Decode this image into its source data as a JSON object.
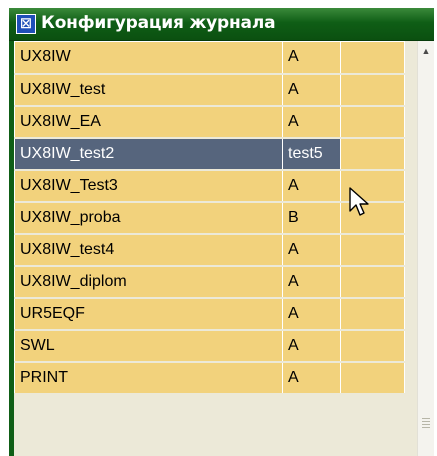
{
  "window": {
    "title": "Конфигурация журнала",
    "icon": "app-icon"
  },
  "rows": [
    {
      "name": "UX8IW",
      "value": "A",
      "selected": false
    },
    {
      "name": "UX8IW_test",
      "value": "A",
      "selected": false
    },
    {
      "name": "UX8IW_EA",
      "value": "A",
      "selected": false
    },
    {
      "name": "UX8IW_test2",
      "value": "test5",
      "selected": true
    },
    {
      "name": "UX8IW_Test3",
      "value": "A",
      "selected": false
    },
    {
      "name": "UX8IW_proba",
      "value": "B",
      "selected": false
    },
    {
      "name": "UX8IW_test4",
      "value": "A",
      "selected": false
    },
    {
      "name": "UX8IW_diplom",
      "value": "A",
      "selected": false
    },
    {
      "name": "UR5EQF",
      "value": "A",
      "selected": false
    },
    {
      "name": "SWL",
      "value": "A",
      "selected": false
    },
    {
      "name": "PRINT",
      "value": "A",
      "selected": false
    }
  ],
  "colors": {
    "titlebar": "#0f5e16",
    "row_bg": "#f2d27c",
    "selected_bg": "#56657d"
  },
  "icons": {
    "app": "app-icon",
    "scroll_up": "chevron-up-icon",
    "cursor": "mouse-pointer-icon"
  }
}
